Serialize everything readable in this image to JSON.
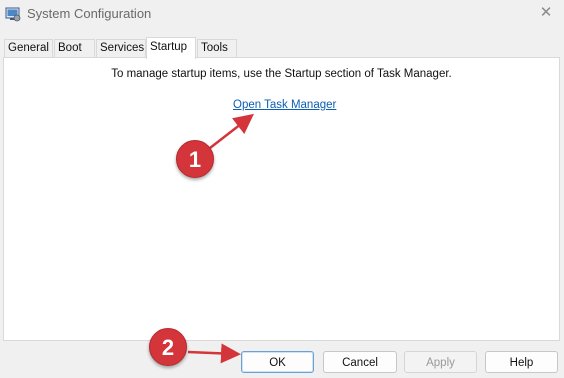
{
  "window": {
    "title": "System Configuration",
    "app_icon": "system-configuration-icon",
    "close_glyph": "✕"
  },
  "tabs": [
    {
      "label": "General",
      "active": false
    },
    {
      "label": "Boot",
      "active": false
    },
    {
      "label": "Services",
      "active": false
    },
    {
      "label": "Startup",
      "active": true
    },
    {
      "label": "Tools",
      "active": false
    }
  ],
  "startup": {
    "message": "To manage startup items, use the Startup section of Task Manager.",
    "link_label": "Open Task Manager"
  },
  "buttons": {
    "ok": "OK",
    "cancel": "Cancel",
    "apply": "Apply",
    "help": "Help"
  },
  "annotations": {
    "step1": "1",
    "step2": "2",
    "color": "#d4353a"
  },
  "colors": {
    "link": "#0b5fb3",
    "window_bg": "#f0f0f0",
    "panel_bg": "#ffffff"
  }
}
